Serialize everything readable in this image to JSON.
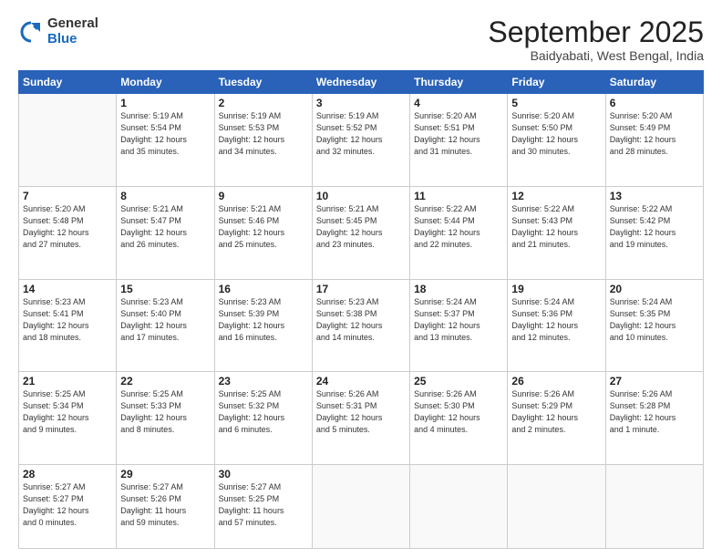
{
  "logo": {
    "general": "General",
    "blue": "Blue"
  },
  "header": {
    "title": "September 2025",
    "location": "Baidyabati, West Bengal, India"
  },
  "days_of_week": [
    "Sunday",
    "Monday",
    "Tuesday",
    "Wednesday",
    "Thursday",
    "Friday",
    "Saturday"
  ],
  "weeks": [
    [
      {
        "day": "",
        "info": ""
      },
      {
        "day": "1",
        "info": "Sunrise: 5:19 AM\nSunset: 5:54 PM\nDaylight: 12 hours\nand 35 minutes."
      },
      {
        "day": "2",
        "info": "Sunrise: 5:19 AM\nSunset: 5:53 PM\nDaylight: 12 hours\nand 34 minutes."
      },
      {
        "day": "3",
        "info": "Sunrise: 5:19 AM\nSunset: 5:52 PM\nDaylight: 12 hours\nand 32 minutes."
      },
      {
        "day": "4",
        "info": "Sunrise: 5:20 AM\nSunset: 5:51 PM\nDaylight: 12 hours\nand 31 minutes."
      },
      {
        "day": "5",
        "info": "Sunrise: 5:20 AM\nSunset: 5:50 PM\nDaylight: 12 hours\nand 30 minutes."
      },
      {
        "day": "6",
        "info": "Sunrise: 5:20 AM\nSunset: 5:49 PM\nDaylight: 12 hours\nand 28 minutes."
      }
    ],
    [
      {
        "day": "7",
        "info": "Sunrise: 5:20 AM\nSunset: 5:48 PM\nDaylight: 12 hours\nand 27 minutes."
      },
      {
        "day": "8",
        "info": "Sunrise: 5:21 AM\nSunset: 5:47 PM\nDaylight: 12 hours\nand 26 minutes."
      },
      {
        "day": "9",
        "info": "Sunrise: 5:21 AM\nSunset: 5:46 PM\nDaylight: 12 hours\nand 25 minutes."
      },
      {
        "day": "10",
        "info": "Sunrise: 5:21 AM\nSunset: 5:45 PM\nDaylight: 12 hours\nand 23 minutes."
      },
      {
        "day": "11",
        "info": "Sunrise: 5:22 AM\nSunset: 5:44 PM\nDaylight: 12 hours\nand 22 minutes."
      },
      {
        "day": "12",
        "info": "Sunrise: 5:22 AM\nSunset: 5:43 PM\nDaylight: 12 hours\nand 21 minutes."
      },
      {
        "day": "13",
        "info": "Sunrise: 5:22 AM\nSunset: 5:42 PM\nDaylight: 12 hours\nand 19 minutes."
      }
    ],
    [
      {
        "day": "14",
        "info": "Sunrise: 5:23 AM\nSunset: 5:41 PM\nDaylight: 12 hours\nand 18 minutes."
      },
      {
        "day": "15",
        "info": "Sunrise: 5:23 AM\nSunset: 5:40 PM\nDaylight: 12 hours\nand 17 minutes."
      },
      {
        "day": "16",
        "info": "Sunrise: 5:23 AM\nSunset: 5:39 PM\nDaylight: 12 hours\nand 16 minutes."
      },
      {
        "day": "17",
        "info": "Sunrise: 5:23 AM\nSunset: 5:38 PM\nDaylight: 12 hours\nand 14 minutes."
      },
      {
        "day": "18",
        "info": "Sunrise: 5:24 AM\nSunset: 5:37 PM\nDaylight: 12 hours\nand 13 minutes."
      },
      {
        "day": "19",
        "info": "Sunrise: 5:24 AM\nSunset: 5:36 PM\nDaylight: 12 hours\nand 12 minutes."
      },
      {
        "day": "20",
        "info": "Sunrise: 5:24 AM\nSunset: 5:35 PM\nDaylight: 12 hours\nand 10 minutes."
      }
    ],
    [
      {
        "day": "21",
        "info": "Sunrise: 5:25 AM\nSunset: 5:34 PM\nDaylight: 12 hours\nand 9 minutes."
      },
      {
        "day": "22",
        "info": "Sunrise: 5:25 AM\nSunset: 5:33 PM\nDaylight: 12 hours\nand 8 minutes."
      },
      {
        "day": "23",
        "info": "Sunrise: 5:25 AM\nSunset: 5:32 PM\nDaylight: 12 hours\nand 6 minutes."
      },
      {
        "day": "24",
        "info": "Sunrise: 5:26 AM\nSunset: 5:31 PM\nDaylight: 12 hours\nand 5 minutes."
      },
      {
        "day": "25",
        "info": "Sunrise: 5:26 AM\nSunset: 5:30 PM\nDaylight: 12 hours\nand 4 minutes."
      },
      {
        "day": "26",
        "info": "Sunrise: 5:26 AM\nSunset: 5:29 PM\nDaylight: 12 hours\nand 2 minutes."
      },
      {
        "day": "27",
        "info": "Sunrise: 5:26 AM\nSunset: 5:28 PM\nDaylight: 12 hours\nand 1 minute."
      }
    ],
    [
      {
        "day": "28",
        "info": "Sunrise: 5:27 AM\nSunset: 5:27 PM\nDaylight: 12 hours\nand 0 minutes."
      },
      {
        "day": "29",
        "info": "Sunrise: 5:27 AM\nSunset: 5:26 PM\nDaylight: 11 hours\nand 59 minutes."
      },
      {
        "day": "30",
        "info": "Sunrise: 5:27 AM\nSunset: 5:25 PM\nDaylight: 11 hours\nand 57 minutes."
      },
      {
        "day": "",
        "info": ""
      },
      {
        "day": "",
        "info": ""
      },
      {
        "day": "",
        "info": ""
      },
      {
        "day": "",
        "info": ""
      }
    ]
  ]
}
